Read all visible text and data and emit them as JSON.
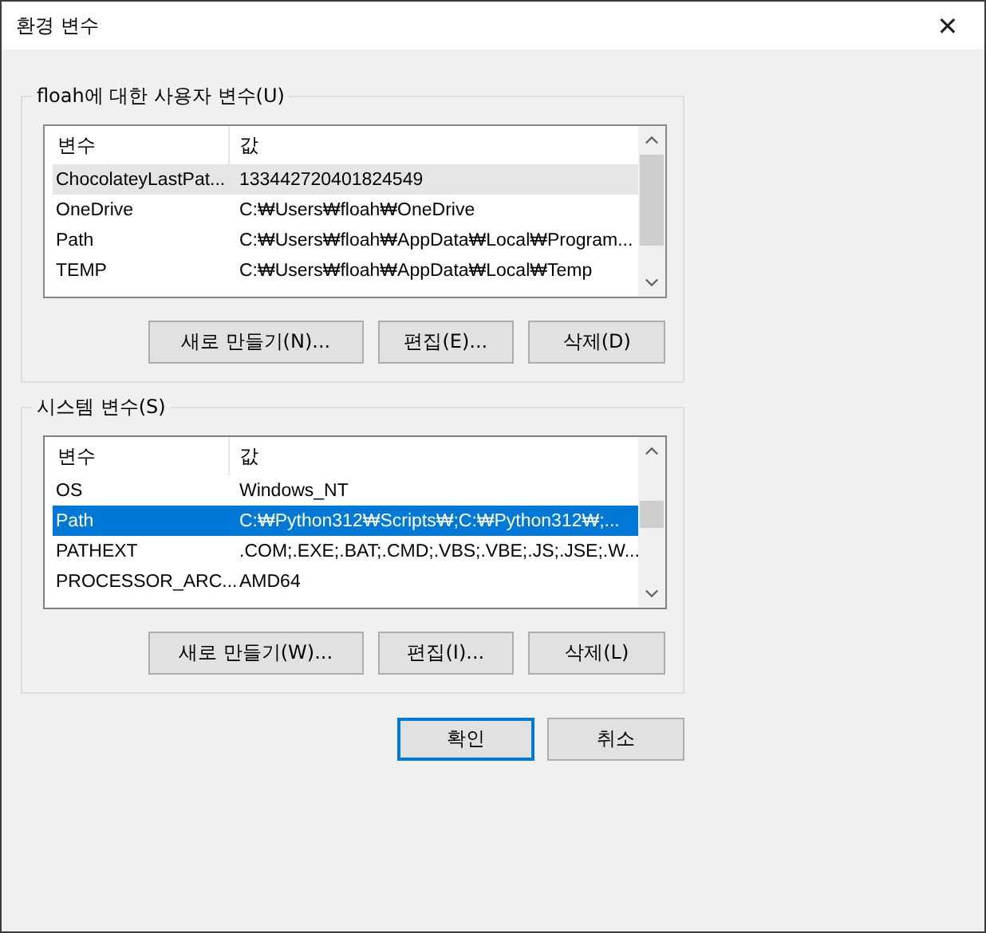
{
  "window": {
    "title": "환경 변수",
    "close": "✕"
  },
  "groups": [
    {
      "title": "floah에 대한 사용자 변수(U)",
      "focused": false,
      "columns": [
        "변수",
        "값"
      ],
      "rows": [
        {
          "name": "ChocolateyLastPat...",
          "value": "133442720401824549",
          "selected": true
        },
        {
          "name": "OneDrive",
          "value": "C:₩Users₩floah₩OneDrive",
          "selected": false
        },
        {
          "name": "Path",
          "value": "C:₩Users₩floah₩AppData₩Local₩Program...",
          "selected": false
        },
        {
          "name": "TEMP",
          "value": "C:₩Users₩floah₩AppData₩Local₩Temp",
          "selected": false
        }
      ],
      "buttons": [
        "새로 만들기(N)...",
        "편집(E)...",
        "삭제(D)"
      ]
    },
    {
      "title": "시스템 변수(S)",
      "focused": true,
      "columns": [
        "변수",
        "값"
      ],
      "rows": [
        {
          "name": "OS",
          "value": "Windows_NT",
          "selected": false
        },
        {
          "name": "Path",
          "value": "C:₩Python312₩Scripts₩;C:₩Python312₩;...",
          "selected": true
        },
        {
          "name": "PATHEXT",
          "value": ".COM;.EXE;.BAT;.CMD;.VBS;.VBE;.JS;.JSE;.W...",
          "selected": false
        },
        {
          "name": "PROCESSOR_ARC...",
          "value": "AMD64",
          "selected": false
        }
      ],
      "buttons": [
        "새로 만들기(W)...",
        "편집(I)...",
        "삭제(L)"
      ]
    }
  ],
  "footer_buttons": [
    {
      "label": "확인",
      "default": true
    },
    {
      "label": "취소",
      "default": false
    }
  ]
}
